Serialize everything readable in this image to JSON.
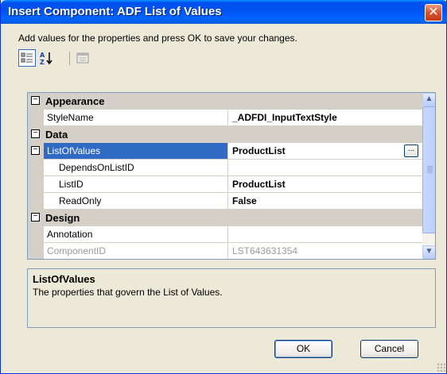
{
  "window": {
    "title": "Insert Component: ADF List of Values",
    "close_label": "✕"
  },
  "instruction": "Add values for the properties and press OK to save your changes.",
  "toolbar": {
    "buttons": [
      {
        "icon": "categorized-icon",
        "pressed": true
      },
      {
        "icon": "alphabetical-sort-icon",
        "pressed": false
      },
      {
        "icon": "property-pages-icon",
        "pressed": false
      }
    ]
  },
  "grid": {
    "categories": [
      {
        "toggle": "−",
        "label": "Appearance"
      },
      {
        "toggle": "−",
        "label": "Data"
      },
      {
        "toggle": "−",
        "label": "Design"
      }
    ],
    "rows": {
      "stylename": {
        "name": "StyleName",
        "value": "_ADFDI_InputTextStyle"
      },
      "listofvalues": {
        "toggle": "−",
        "name": "ListOfValues",
        "value": "ProductList",
        "button": "..."
      },
      "dependsonlistid": {
        "name": "DependsOnListID",
        "value": ""
      },
      "listid": {
        "name": "ListID",
        "value": "ProductList"
      },
      "readonly": {
        "name": "ReadOnly",
        "value": "False"
      },
      "annotation": {
        "name": "Annotation",
        "value": ""
      },
      "componentid": {
        "name": "ComponentID",
        "value": "LST643631354"
      }
    },
    "scrollbar": {
      "up": "▲",
      "down": "▼"
    }
  },
  "help": {
    "title": "ListOfValues",
    "text": "The properties that govern the List of Values."
  },
  "buttons": {
    "ok": "OK",
    "cancel": "Cancel"
  }
}
